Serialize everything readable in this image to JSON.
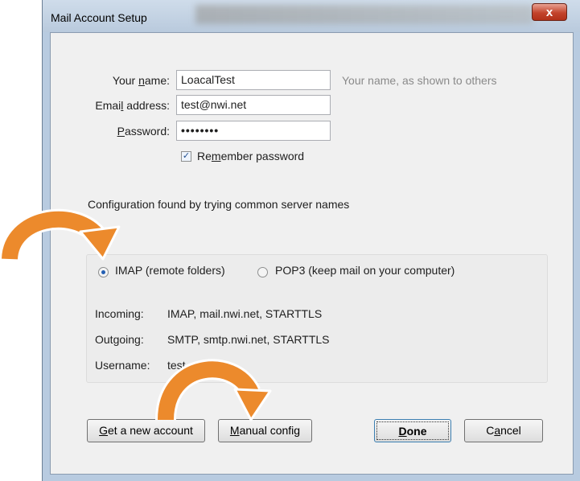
{
  "window": {
    "title": "Mail Account Setup",
    "close_glyph": "x"
  },
  "form": {
    "name_label_pre": "Your ",
    "name_label_acc": "n",
    "name_label_post": "ame:",
    "name_value": "LoacalTest",
    "name_hint": "Your name, as shown to others",
    "email_label_pre": "Emai",
    "email_label_acc": "l",
    "email_label_post": " address:",
    "email_value": "test@nwi.net",
    "password_label_acc": "P",
    "password_label_post": "assword:",
    "password_value": "••••••••",
    "remember_pre": "Re",
    "remember_acc": "m",
    "remember_post": "ember password",
    "remember_checked": true
  },
  "config": {
    "status_text": "Configuration found by trying common server names",
    "imap_label": "IMAP (remote folders)",
    "pop3_label": "POP3 (keep mail on your computer)",
    "selected": "IMAP",
    "incoming_label": "Incoming:",
    "incoming_value": "IMAP, mail.nwi.net, STARTTLS",
    "outgoing_label": "Outgoing:",
    "outgoing_value": "SMTP, smtp.nwi.net, STARTTLS",
    "username_label": "Username:",
    "username_value": "test"
  },
  "buttons": {
    "new_account_acc": "G",
    "new_account_post": "et a new account",
    "manual_acc": "M",
    "manual_post": "anual config",
    "done_acc": "D",
    "done_post": "one",
    "cancel_pre": "C",
    "cancel_acc": "a",
    "cancel_post": "ncel"
  },
  "colors": {
    "arrow": "#ec8a2c",
    "arrow_outline": "#ffffff"
  }
}
